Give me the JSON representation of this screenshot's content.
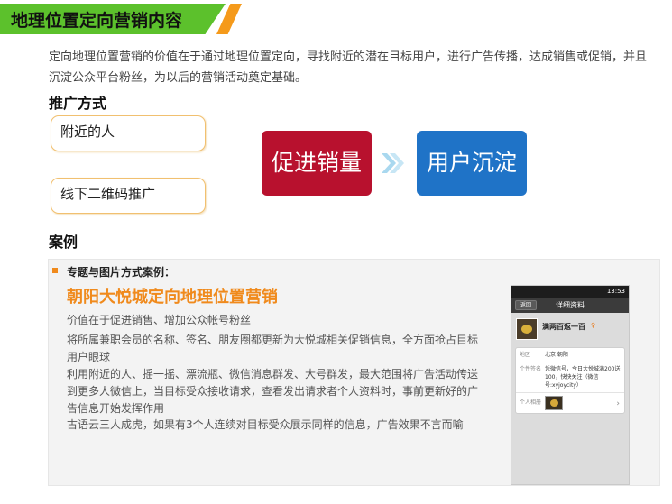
{
  "header": {
    "title": "地理位置定向营销内容"
  },
  "intro": "定向地理位置营销的价值在于通过地理位置定向，寻找附近的潜在目标用户，进行广告传播，达成销售或促销，并且沉淀公众平台粉丝，为以后的营销活动奠定基础。",
  "promotion": {
    "heading": "推广方式",
    "methods": [
      "附近的人",
      "线下二维码推广"
    ],
    "flow": {
      "from": "促进销量",
      "to": "用户沉淀"
    }
  },
  "case": {
    "heading": "案例",
    "subheading": "专题与图片方式案例：",
    "title": "朝阳大悦城定向地理位置营销",
    "paragraphs": [
      "价值在于促进销售、增加公众帐号粉丝",
      "将所属兼职会员的名称、签名、朋友圈都更新为大悦城相关促销信息，全方面抢占目标用户眼球",
      "利用附近的人、摇一摇、漂流瓶、微信消息群发、大号群发，最大范围将广告活动传送到更多人微信上，当目标受众接收请求，查看发出请求者个人资料时，事前更新好的广告信息开始发挥作用",
      "古语云三人成虎，如果有3个人连续对目标受众展示同样的信息，广告效果不言而喻"
    ]
  },
  "phone": {
    "time": "13:53",
    "back": "返回",
    "nav_title": "详细资料",
    "profile_name": "满两百返一百",
    "rows": {
      "region_label": "地区",
      "region_value": "北京 朝阳",
      "signature_label": "个性签名",
      "signature_value": "凭微信号，今日大悦城满200送100，快快关注（微信号:xyjoycity）",
      "album_label": "个人相册"
    }
  },
  "colors": {
    "banner_green": "#5cc12c",
    "banner_orange": "#f59a1b",
    "case_title": "#f08a1c",
    "flow_red": "#b8112e",
    "flow_blue": "#1f73c7"
  },
  "icons": {
    "flow_arrow": "double-chevron-right-icon",
    "phone_chevron": "chevron-right-icon",
    "gender": "female-icon"
  }
}
